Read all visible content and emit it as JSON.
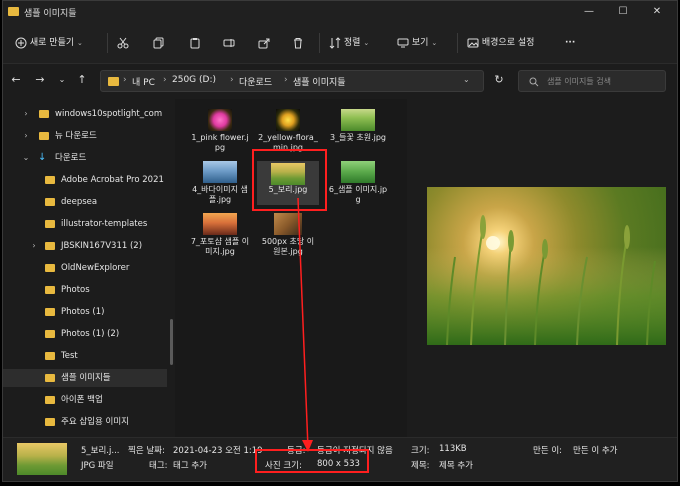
{
  "window": {
    "title": "샘플 이미지들"
  },
  "toolbar": {
    "new_label": "새로 만들기",
    "sort_label": "정렬",
    "view_label": "보기",
    "background_label": "배경으로 설정",
    "more_label": "···"
  },
  "address": {
    "crumbs": [
      "내 PC",
      "250G (D:)",
      "다운로드",
      "샘플 이미지들"
    ]
  },
  "search": {
    "placeholder": "샘플 이미지들 검색"
  },
  "sidebar": {
    "items": [
      {
        "label": "windows10spotlight_com"
      },
      {
        "label": "뉴 다운로드"
      },
      {
        "label": "다운로드"
      },
      {
        "label": "Adobe Acrobat Pro 2021"
      },
      {
        "label": "deepsea"
      },
      {
        "label": "illustrator-templates"
      },
      {
        "label": "JBSKIN167V311 (2)"
      },
      {
        "label": "OldNewExplorer"
      },
      {
        "label": "Photos"
      },
      {
        "label": "Photos (1)"
      },
      {
        "label": "Photos (1) (2)"
      },
      {
        "label": "Test"
      },
      {
        "label": "샘플 이미지들"
      },
      {
        "label": "아이폰 백업"
      },
      {
        "label": "주요 삽입용 이미지"
      }
    ]
  },
  "files": [
    {
      "name": "1_pink flower.jpg"
    },
    {
      "name": "2_yellow-flora_min.jpg"
    },
    {
      "name": "3_들꽃 초원.jpg"
    },
    {
      "name": "4_바다이미지 샘플.jpg"
    },
    {
      "name": "5_보리.jpg"
    },
    {
      "name": "6_샘플 이미지.jpg"
    },
    {
      "name": "7_포토샵 샘플 이미지.jpg"
    },
    {
      "name": "500px 초당 이 원본.jpg"
    }
  ],
  "status": {
    "file_name": "5_보리.j...",
    "file_type": "JPG 파일",
    "date_label": "찍은 날짜:",
    "date_value": "2021-04-23 오전 1:19",
    "tags_label": "태그:",
    "tags_value": "태그 추가",
    "rating_label": "등급:",
    "rating_value": "등급이 지정되지 않음",
    "size_label": "크기:",
    "size_value": "113KB",
    "dimensions_label": "사진 크기:",
    "dimensions_value": "800 x 533",
    "title_label": "제목:",
    "title_value": "제목 추가",
    "author_label": "만든 이:",
    "author_value": "만든 이 추가"
  },
  "colors": {
    "accent": "#ff1f1f",
    "folder": "#e8b93f",
    "download": "#4cc2ff"
  }
}
